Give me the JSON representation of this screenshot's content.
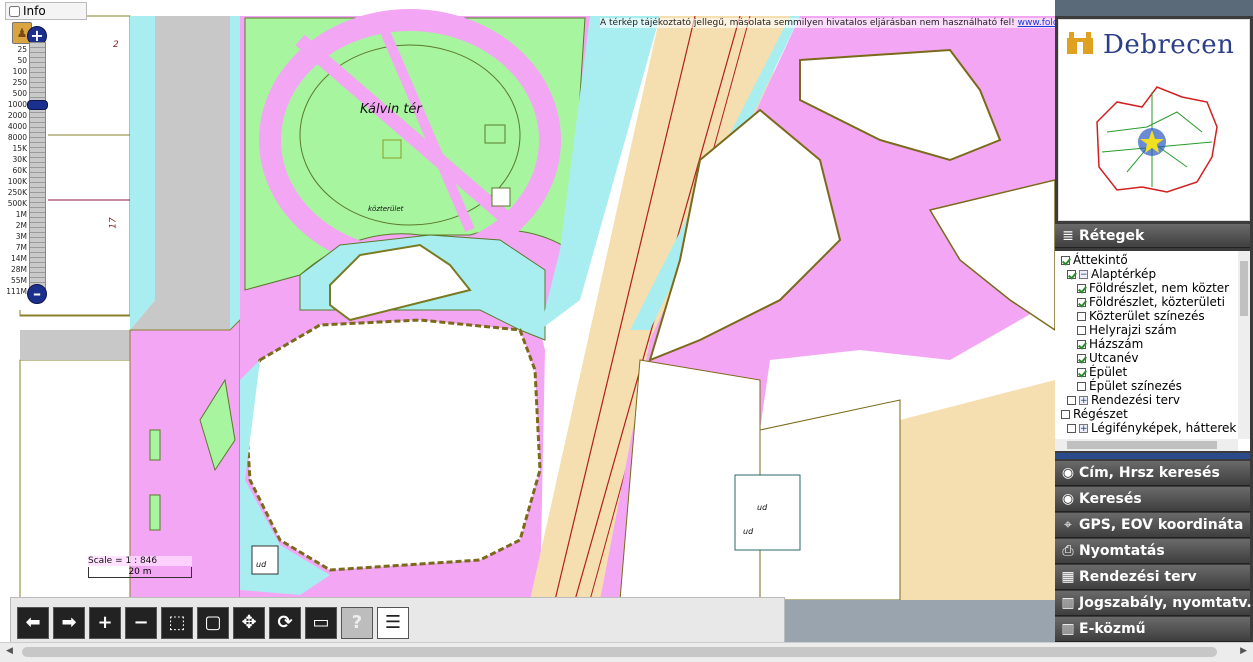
{
  "info": {
    "label": "Info",
    "checked": false
  },
  "disclaimer": {
    "text": "A térkép tájékoztató jellegű, másolata semmilyen hivatalos eljárásban nem használható fel! ",
    "link": "www.foldhivatal.hu"
  },
  "zoom": {
    "in_label": "+",
    "out_label": "–",
    "levels": [
      "25",
      "50",
      "100",
      "250",
      "500",
      "1000",
      "2000",
      "4000",
      "8000",
      "15K",
      "30K",
      "60K",
      "100K",
      "250K",
      "500K",
      "1M",
      "2M",
      "3M",
      "7M",
      "14M",
      "28M",
      "55M",
      "111M"
    ]
  },
  "map_labels": {
    "square": "Kálvin tér",
    "street": "közterület",
    "lot_a": "2",
    "lot_b": "17",
    "udvar_1": "ud",
    "udvar_2": "ud",
    "udvar_3": "ud"
  },
  "scale": {
    "text": "Scale = 1 : 846",
    "bar": "20 m"
  },
  "toolbar": {
    "back": "⬅",
    "forward": "➡",
    "zoom_in": "+",
    "zoom_out": "−",
    "zoom_box": "⬚",
    "full_extent": "▢",
    "pan": "✥",
    "refresh": "⟳",
    "measure": "▭",
    "help": "?",
    "legend": "☰"
  },
  "brand": {
    "title": "Debrecen"
  },
  "layers": {
    "header": "Rétegek",
    "items": [
      {
        "label": "Áttekintő",
        "indent": 0,
        "checked": true,
        "expander": ""
      },
      {
        "label": "Alaptérkép",
        "indent": 1,
        "checked": true,
        "expander": "−"
      },
      {
        "label": "Földrészlet, nem közter",
        "indent": 2,
        "checked": true,
        "expander": ""
      },
      {
        "label": "Földrészlet, közterületi",
        "indent": 2,
        "checked": true,
        "expander": ""
      },
      {
        "label": "Közterület színezés",
        "indent": 2,
        "checked": false,
        "expander": ""
      },
      {
        "label": "Helyrajzi szám",
        "indent": 2,
        "checked": false,
        "expander": ""
      },
      {
        "label": "Házszám",
        "indent": 2,
        "checked": true,
        "expander": ""
      },
      {
        "label": "Utcanév",
        "indent": 2,
        "checked": true,
        "expander": ""
      },
      {
        "label": "Épület",
        "indent": 2,
        "checked": true,
        "expander": ""
      },
      {
        "label": "Épület színezés",
        "indent": 2,
        "checked": false,
        "expander": ""
      },
      {
        "label": "Rendezési terv",
        "indent": 1,
        "checked": false,
        "expander": "+"
      },
      {
        "label": "Régészet",
        "indent": 0,
        "checked": false,
        "expander": ""
      },
      {
        "label": "Légifényképek, hátterek",
        "indent": 1,
        "checked": false,
        "expander": "+"
      }
    ]
  },
  "nav": [
    {
      "label": "Cím, Hrsz keresés",
      "icon": "◉"
    },
    {
      "label": "Keresés",
      "icon": "◉"
    },
    {
      "label": "GPS, EOV koordináta",
      "icon": "⌖"
    },
    {
      "label": "Nyomtatás",
      "icon": "⎙"
    },
    {
      "label": "Rendezési terv",
      "icon": "▦"
    },
    {
      "label": "Jogszabály, nyomtatv.",
      "icon": "▥"
    },
    {
      "label": "E-közmű",
      "icon": "▥"
    }
  ]
}
